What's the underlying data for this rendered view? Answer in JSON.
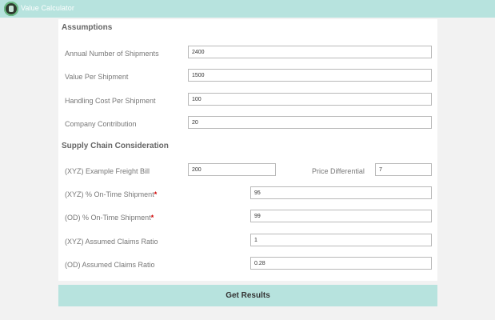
{
  "app": {
    "title": "Value Calculator",
    "logo_icon": "logo-icon"
  },
  "assumptions": {
    "title": "Assumptions",
    "fields": {
      "annual_shipments": {
        "label": "Annual Number of Shipments",
        "value": "2400"
      },
      "value_per_shipment": {
        "label": "Value Per Shipment",
        "value": "1500"
      },
      "handling_cost": {
        "label": "Handling Cost Per Shipment",
        "value": "100"
      },
      "company_contribution": {
        "label": "Company Contribution",
        "value": "20"
      }
    }
  },
  "supply_chain": {
    "title": "Supply Chain Consideration",
    "freight_bill": {
      "label": "(XYZ) Example Freight Bill",
      "value": "200"
    },
    "price_differential": {
      "label": "Price Differential",
      "value": "7"
    },
    "xyz_on_time": {
      "label": "(XYZ) % On-Time Shipment",
      "required_mark": "*",
      "value": "95"
    },
    "od_on_time": {
      "label": "(OD) % On-Time Shipment",
      "required_mark": "*",
      "value": "99"
    },
    "xyz_claims": {
      "label": "(XYZ) Assumed Claims Ratio",
      "value": "1"
    },
    "od_claims": {
      "label": "(OD) Assumed Claims Ratio",
      "value": "0.28"
    }
  },
  "actions": {
    "submit_label": "Get Results"
  },
  "colors": {
    "accent": "#b7e3de",
    "required": "#d10000"
  }
}
